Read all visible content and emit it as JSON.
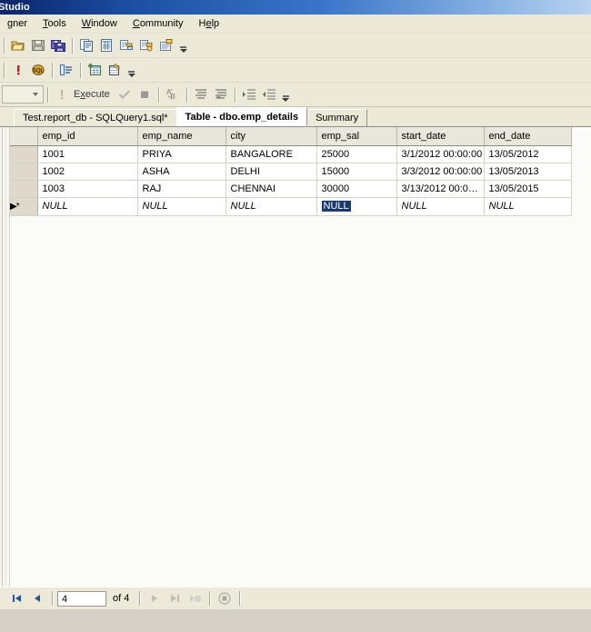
{
  "window": {
    "title": "Studio"
  },
  "menubar": {
    "items": [
      {
        "label": "gner",
        "accel": ""
      },
      {
        "label": "Tools",
        "accel": "T"
      },
      {
        "label": "Window",
        "accel": "W"
      },
      {
        "label": "Community",
        "accel": "C"
      },
      {
        "label": "Help",
        "accel": "H"
      }
    ]
  },
  "toolbars": {
    "row1": [
      {
        "name": "open-file-icon",
        "tip": "Open File"
      },
      {
        "name": "save-icon",
        "tip": "Save"
      },
      {
        "name": "save-all-icon",
        "tip": "Save All"
      },
      {
        "name": "new-query-icon",
        "tip": "New Query"
      },
      {
        "name": "database-engine-query-icon",
        "tip": "Database Engine Query"
      },
      {
        "name": "analysis-services-mdx-query-icon",
        "tip": "Analysis Services MDX Query"
      },
      {
        "name": "analysis-services-dmx-query-icon",
        "tip": "Analysis Services DMX Query"
      },
      {
        "name": "sql-server-compact-query-icon",
        "tip": "SQL Server Compact Query"
      }
    ],
    "row2": [
      {
        "name": "execute-icon",
        "tip": "Execute"
      },
      {
        "name": "sql-icon",
        "tip": "SQL"
      },
      {
        "name": "object-explorer-icon",
        "tip": "Object Explorer Details"
      },
      {
        "name": "new-table-icon",
        "tip": "New Table"
      },
      {
        "name": "design-table-icon",
        "tip": "Design Table"
      }
    ],
    "row3": {
      "combo_value": "",
      "execute_label": "Execute",
      "execute_accel": "x",
      "buttons": [
        {
          "name": "execute-icon",
          "tip": "Execute"
        },
        {
          "name": "parse-checkmark-icon",
          "tip": "Parse"
        },
        {
          "name": "stop-icon",
          "tip": "Stop"
        },
        {
          "name": "display-estimated-plan-icon",
          "tip": "Display Estimated Execution Plan"
        },
        {
          "name": "results-to-text-icon",
          "tip": "Results to Text"
        },
        {
          "name": "results-to-grid-icon",
          "tip": "Results to Grid"
        },
        {
          "name": "indent-increase-icon",
          "tip": "Increase Indent"
        },
        {
          "name": "indent-decrease-icon",
          "tip": "Decrease Indent"
        }
      ]
    }
  },
  "tabs": [
    {
      "label": "Test.report_db - SQLQuery1.sql*",
      "active": false
    },
    {
      "label": "Table - dbo.emp_details",
      "active": true
    },
    {
      "label": "Summary",
      "active": false
    }
  ],
  "grid": {
    "columns": [
      "emp_id",
      "emp_name",
      "city",
      "emp_sal",
      "start_date",
      "end_date"
    ],
    "rows": [
      {
        "selector": "",
        "cells": [
          "1001",
          "PRIYA",
          "BANGALORE",
          "25000",
          "3/1/2012 00:00:00",
          "13/05/2012"
        ]
      },
      {
        "selector": "",
        "cells": [
          "1002",
          "ASHA",
          "DELHI",
          "15000",
          "3/3/2012 00:00:00",
          "13/05/2013"
        ]
      },
      {
        "selector": "",
        "cells": [
          "1003",
          "RAJ",
          "CHENNAI",
          "30000",
          "3/13/2012 00:0…",
          "13/05/2015"
        ]
      },
      {
        "selector": "▶*",
        "cells": [
          "NULL",
          "NULL",
          "NULL",
          "NULL",
          "NULL",
          "NULL"
        ],
        "is_new_row": true,
        "selected_cell_index": 3
      }
    ]
  },
  "navbar": {
    "first_label": "first-record",
    "prev_label": "previous-record",
    "current_record": "4",
    "of_label": "of 4",
    "next_label": "next-record",
    "last_label": "last-record",
    "new_label": "new-record",
    "stop_label": "stop"
  },
  "colors": {
    "title_start": "#0a246a",
    "title_end": "#b9d2ef",
    "chrome": "#ece9d8",
    "grid_header": "#e9e6dc",
    "row_selector": "#ded9cb",
    "selection": "#193a6e",
    "app_background": "#d4d0c8"
  }
}
